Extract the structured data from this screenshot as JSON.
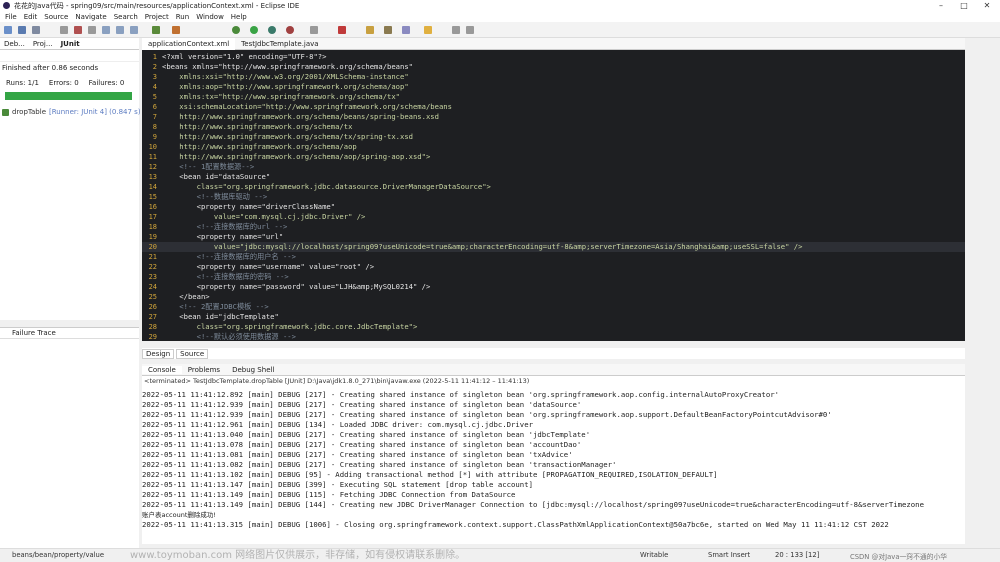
{
  "window": {
    "title": "花花的Java代码 - spring09/src/main/resources/applicationContext.xml - Eclipse IDE"
  },
  "menu": [
    "File",
    "Edit",
    "Source",
    "Navigate",
    "Search",
    "Project",
    "Run",
    "Window",
    "Help"
  ],
  "left_tabs": [
    "Deb...",
    "Proj...",
    "JUnit"
  ],
  "junit": {
    "finished": "Finished after 0.86 seconds",
    "runs": "Runs: 1/1",
    "errors": "Errors: 0",
    "failures": "Failures: 0",
    "test": "dropTable",
    "runner": "[Runner: JUnit 4] (0.847 s)"
  },
  "failure_trace": "Failure Trace",
  "editor_tabs": [
    "applicationContext.xml",
    "TestJdbcTemplate.java"
  ],
  "code_lines": [
    {
      "n": "1",
      "t": "<?xml version=\"1.0\" encoding=\"UTF-8\"?>"
    },
    {
      "n": "2",
      "t": "<beans xmlns=\"http://www.springframework.org/schema/beans\""
    },
    {
      "n": "3",
      "t": "    xmlns:xsi=\"http://www.w3.org/2001/XMLSchema-instance\""
    },
    {
      "n": "4",
      "t": "    xmlns:aop=\"http://www.springframework.org/schema/aop\""
    },
    {
      "n": "5",
      "t": "    xmlns:tx=\"http://www.springframework.org/schema/tx\""
    },
    {
      "n": "6",
      "t": "    xsi:schemaLocation=\"http://www.springframework.org/schema/beans"
    },
    {
      "n": "7",
      "t": "    http://www.springframework.org/schema/beans/spring-beans.xsd"
    },
    {
      "n": "8",
      "t": "    http://www.springframework.org/schema/tx"
    },
    {
      "n": "9",
      "t": "    http://www.springframework.org/schema/tx/spring-tx.xsd"
    },
    {
      "n": "10",
      "t": "    http://www.springframework.org/schema/aop"
    },
    {
      "n": "11",
      "t": "    http://www.springframework.org/schema/aop/spring-aop.xsd\">"
    },
    {
      "n": "12",
      "t": "    <!-- 1配置数据源-->"
    },
    {
      "n": "13",
      "t": "    <bean id=\"dataSource\""
    },
    {
      "n": "14",
      "t": "        class=\"org.springframework.jdbc.datasource.DriverManagerDataSource\">"
    },
    {
      "n": "15",
      "t": "        <!--数据库驱动 -->"
    },
    {
      "n": "16",
      "t": "        <property name=\"driverClassName\""
    },
    {
      "n": "17",
      "t": "            value=\"com.mysql.cj.jdbc.Driver\" />"
    },
    {
      "n": "18",
      "t": "        <!--连接数据库的url -->"
    },
    {
      "n": "19",
      "t": "        <property name=\"url\""
    },
    {
      "n": "20",
      "t": "            value=\"jdbc:mysql://localhost/spring09?useUnicode=true&amp;characterEncoding=utf-8&amp;serverTimezone=Asia/Shanghai&amp;useSSL=false\" />"
    },
    {
      "n": "21",
      "t": "        <!--连接数据库的用户名 -->"
    },
    {
      "n": "22",
      "t": "        <property name=\"username\" value=\"root\" />"
    },
    {
      "n": "23",
      "t": "        <!--连接数据库的密码 -->"
    },
    {
      "n": "24",
      "t": "        <property name=\"password\" value=\"LJH&amp;MySQL0214\" />"
    },
    {
      "n": "25",
      "t": "    </bean>"
    },
    {
      "n": "26",
      "t": "    <!-- 2配置JDBC模板 -->"
    },
    {
      "n": "27",
      "t": "    <bean id=\"jdbcTemplate\""
    },
    {
      "n": "28",
      "t": "        class=\"org.springframework.jdbc.core.JdbcTemplate\">"
    },
    {
      "n": "29",
      "t": "        <!--默认必须使用数据源 -->"
    }
  ],
  "design_tabs": [
    "Design",
    "Source"
  ],
  "console_tabs": [
    "Console",
    "Problems",
    "Debug Shell"
  ],
  "terminated": "<terminated> TestJdbcTemplate.dropTable [JUnit] D:\\Java\\jdk1.8.0_271\\bin\\javaw.exe  (2022-5-11 11:41:12 – 11:41:13)",
  "console_lines": [
    "2022-05-11 11:41:12.892 [main] DEBUG [217] - Creating shared instance of singleton bean 'org.springframework.aop.config.internalAutoProxyCreator'",
    "2022-05-11 11:41:12.939 [main] DEBUG [217] - Creating shared instance of singleton bean 'dataSource'",
    "2022-05-11 11:41:12.939 [main] DEBUG [217] - Creating shared instance of singleton bean 'org.springframework.aop.support.DefaultBeanFactoryPointcutAdvisor#0'",
    "2022-05-11 11:41:12.961 [main] DEBUG [134] - Loaded JDBC driver: com.mysql.cj.jdbc.Driver",
    "2022-05-11 11:41:13.040 [main] DEBUG [217] - Creating shared instance of singleton bean 'jdbcTemplate'",
    "2022-05-11 11:41:13.078 [main] DEBUG [217] - Creating shared instance of singleton bean 'accountDao'",
    "2022-05-11 11:41:13.081 [main] DEBUG [217] - Creating shared instance of singleton bean 'txAdvice'",
    "2022-05-11 11:41:13.082 [main] DEBUG [217] - Creating shared instance of singleton bean 'transactionManager'",
    "2022-05-11 11:41:13.102 [main] DEBUG [95] - Adding transactional method [*] with attribute [PROPAGATION_REQUIRED,ISOLATION_DEFAULT]",
    "2022-05-11 11:41:13.147 [main] DEBUG [399] - Executing SQL statement [drop table account]",
    "2022-05-11 11:41:13.149 [main] DEBUG [115] - Fetching JDBC Connection from DataSource",
    "2022-05-11 11:41:13.149 [main] DEBUG [144] - Creating new JDBC DriverManager Connection to [jdbc:mysql://localhost/spring09?useUnicode=true&characterEncoding=utf-8&serverTimezone",
    "账户表account删除成功!",
    "2022-05-11 11:41:13.315 [main] DEBUG [1006] - Closing org.springframework.context.support.ClassPathXmlApplicationContext@50a7bc6e, started on Wed May 11 11:41:12 CST 2022"
  ],
  "status": {
    "path": "beans/bean/property/value",
    "writable": "Writable",
    "insert": "Smart Insert",
    "pos": "20 : 133 [12]"
  },
  "watermark": "www.toymoban.com 网络图片仅供展示，非存储，如有侵权请联系删除。",
  "csdn": "CSDN @对Java一窍不通的小华"
}
